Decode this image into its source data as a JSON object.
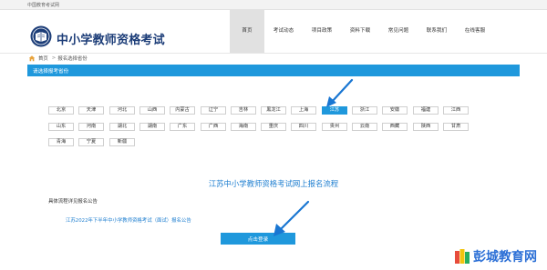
{
  "topbar": {
    "text": "中国教育考试网"
  },
  "header": {
    "site_title": "中小学教师资格考试"
  },
  "nav": {
    "items": [
      {
        "label": "首页",
        "active": true
      },
      {
        "label": "考试动态",
        "active": false
      },
      {
        "label": "项目政策",
        "active": false
      },
      {
        "label": "资料下载",
        "active": false
      },
      {
        "label": "常见问题",
        "active": false
      },
      {
        "label": "联系我们",
        "active": false
      },
      {
        "label": "在线客服",
        "active": false
      }
    ]
  },
  "breadcrumb": {
    "home": "首页",
    "separator": ">",
    "current": "报名选择省份"
  },
  "province_bar": {
    "title": "请选择报考省份"
  },
  "provinces": {
    "selected": "江苏",
    "rows": [
      [
        "北京",
        "天津",
        "河北",
        "山西",
        "内蒙古",
        "辽宁",
        "吉林",
        "黑龙江",
        "上海",
        "江苏",
        "浙江",
        "安徽",
        "福建",
        "江西"
      ],
      [
        "山东",
        "河南",
        "湖北",
        "湖南",
        "广东",
        "广西",
        "海南",
        "重庆",
        "四川",
        "贵州",
        "云南",
        "西藏",
        "陕西",
        "甘肃"
      ],
      [
        "青海",
        "宁夏",
        "新疆"
      ]
    ]
  },
  "flow": {
    "title": "江苏中小学教师资格考试网上报名流程",
    "notice_label": "具体流程详见报名公告",
    "notice_link": "江苏2022年下半年中小学教师资格考试（面试）报名公告",
    "login_button": "点击登录"
  },
  "watermark": {
    "text": "彭城教育网"
  },
  "colors": {
    "accent": "#1f98dc",
    "title": "#1c3d78",
    "link": "#1f7fd0",
    "arrow": "#1976d2"
  }
}
